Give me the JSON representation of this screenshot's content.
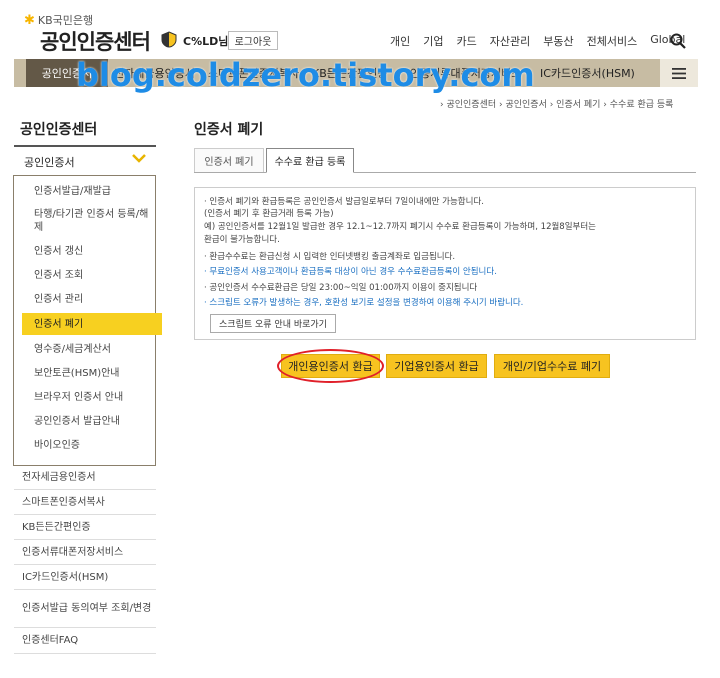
{
  "header": {
    "bank_name": "KB국민은행",
    "site_title": "공인인증센터",
    "user_name": "C%LD님",
    "logout_label": "로그아웃",
    "top_nav": [
      "개인",
      "기업",
      "카드",
      "자산관리",
      "부동산",
      "전체서비스",
      "Global"
    ]
  },
  "gnb": {
    "active_label": "공인인증서",
    "items": [
      "전자세금용인증서",
      "스마트폰인증서복사",
      "KB든든간편인증",
      "인증서류대폰저장서비스",
      "IC카드인증서(HSM)"
    ]
  },
  "watermark": "blog.coldzero.tistory.com",
  "breadcrumb": "› 공인인증센터 › 공인인증서 › 인증서 폐기 › 수수료 환급 등록",
  "sidebar": {
    "title": "공인인증센터",
    "section": "공인인증서",
    "sub_items": [
      "인증서발급/재발급",
      "타행/타기관 인증서 등록/해제",
      "인증서 갱신",
      "인증서 조회",
      "인증서 관리",
      "인증서 폐기",
      "영수증/세금계산서",
      "보안토큰(HSM)안내",
      "브라우저 인증서 안내",
      "공인인증서 발급안내",
      "바이오인증"
    ],
    "items": [
      "전자세금용인증서",
      "스마트폰인증서복사",
      "KB든든간편인증",
      "인증서류대폰저장서비스",
      "IC카드인증서(HSM)",
      "인증서발급 동의여부 조회/변경",
      "인증센터FAQ"
    ]
  },
  "content": {
    "title": "인증서 폐기",
    "tabs": [
      "인증서 폐기",
      "수수료 환급 등록"
    ],
    "notice": [
      "· 인증서 폐기와 환급등록은 공인인증서 발급일로부터 7일이내에만 가능합니다.",
      "  (인증서 폐기 후 환급거래 등록 가능)",
      "  예) 공인인증서를 12월1일 발급한 경우 12.1~12.7까지 폐기시 수수료 환급등록이 가능하며, 12월8일부터는",
      "  환급이 불가능합니다.",
      "· 환급수수료는 환급신청 시 입력한 인터넷뱅킹 출금계좌로 입금됩니다.",
      "· 무료인증서 사용고객이나 환급등록 대상이 아닌 경우 수수료환급등록이 안됩니다.",
      "· 공인인증서 수수료환급은 당일 23:00~익일 01:00까지 이용이 중지됩니다",
      "· 스크립트 오류가 발생하는 경우, 호환성 보기로 설정을 변경하여 이용해 주시기 바랍니다."
    ],
    "script_button": "스크립트 오류 안내 바로가기",
    "buttons": [
      "개인용인증서 환급",
      "기업용인증서 환급",
      "개인/기업수수료 폐기"
    ]
  },
  "colors": {
    "gnb_bar": "#c7bca3",
    "gnb_active": "#635847",
    "highlight_yellow": "#f7d020",
    "button_yellow": "#f7c320",
    "annotation_red": "#e0202a",
    "notice_blue": "#1a6fc2"
  }
}
